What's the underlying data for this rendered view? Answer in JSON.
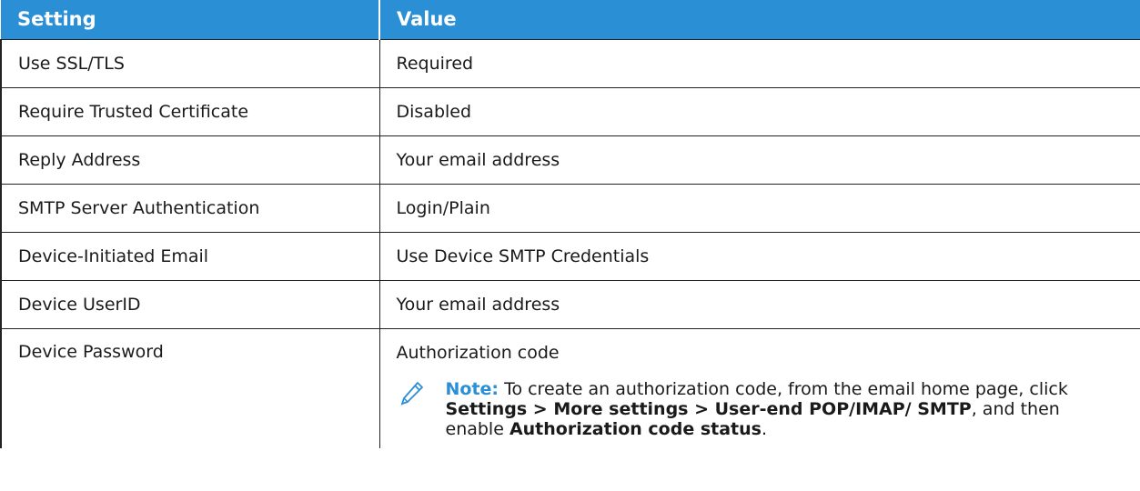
{
  "table": {
    "header": {
      "setting": "Setting",
      "value": "Value"
    },
    "rows": [
      {
        "setting": "Use SSL/TLS",
        "value": "Required"
      },
      {
        "setting": "Require Trusted Certificate",
        "value": "Disabled"
      },
      {
        "setting": "Reply Address",
        "value": "Your email address"
      },
      {
        "setting": "SMTP Server Authentication",
        "value": "Login/Plain"
      },
      {
        "setting": "Device-Initiated Email",
        "value": "Use Device SMTP Credentials"
      },
      {
        "setting": "Device UserID",
        "value": "Your email address"
      },
      {
        "setting": "Device Password",
        "value": "Authorization code"
      }
    ]
  },
  "note": {
    "icon": "pencil-icon",
    "label": "Note:",
    "text_1": " To create an authorization code, from the email home page, click ",
    "path": "Settings > More settings > User-end POP/IMAP/ SMTP",
    "text_2": ", and then enable ",
    "target": "Authorization code status",
    "text_3": "."
  },
  "colors": {
    "header_bg": "#2b8fd6",
    "header_text": "#ffffff",
    "note_label": "#2b8fd6",
    "border": "#222222"
  }
}
